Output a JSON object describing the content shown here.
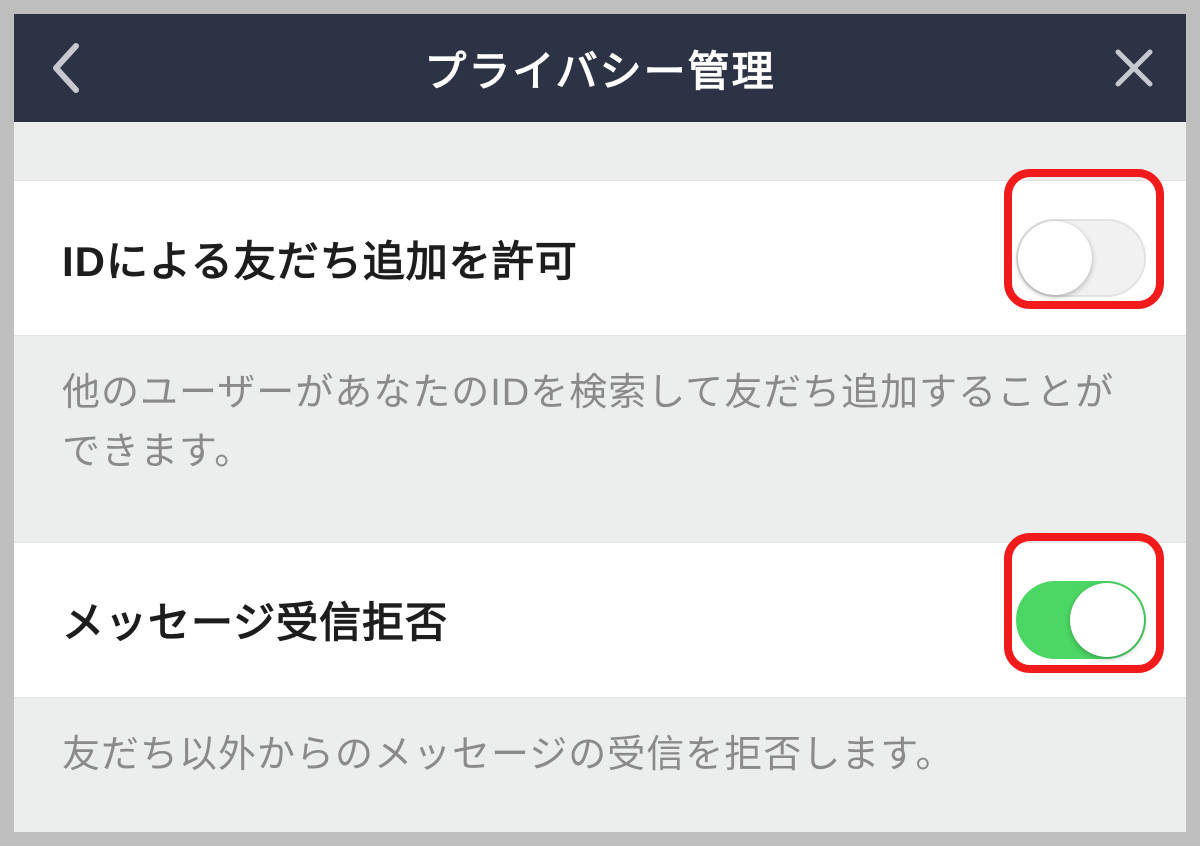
{
  "header": {
    "title": "プライバシー管理"
  },
  "settings": [
    {
      "label": "IDによる友だち追加を許可",
      "description": "他のユーザーがあなたのIDを検索して友だち追加することができます。",
      "enabled": false
    },
    {
      "label": "メッセージ受信拒否",
      "description": "友だち以外からのメッセージの受信を拒否します。",
      "enabled": true
    }
  ]
}
